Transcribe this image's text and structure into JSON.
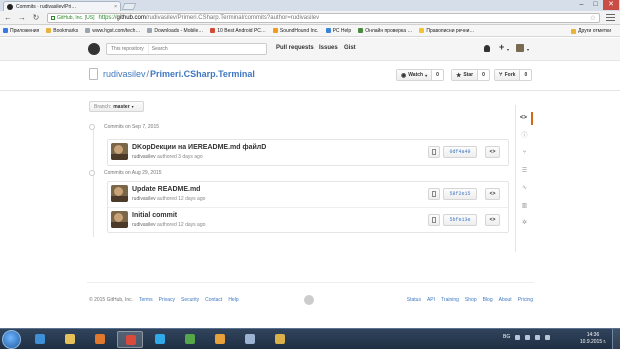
{
  "browser": {
    "tab_title": "Commits · rudivasilev/Pri…",
    "tab_close": "×",
    "win_min": "–",
    "win_max": "□",
    "win_close": "✕",
    "ev_cert": "GitHub, Inc. [US]",
    "url_https": "https://",
    "url_host": "github.com",
    "url_path": "/rudivasilev/Primeri.CSharp.Terminal/commits?author=rudivasilev",
    "back": "←",
    "forward": "→",
    "reload": "↻",
    "star": "☆",
    "bookmarks": [
      {
        "label": "Приложения",
        "color": "#3b78e7"
      },
      {
        "label": "Bookmarks",
        "color": "#e8b33b"
      },
      {
        "label": "www.hgst.com/tech…",
        "color": "#9aa5b1"
      },
      {
        "label": "Downloads - Mobile…",
        "color": "#9aa5b1"
      },
      {
        "label": "10 Best Android PC…",
        "color": "#d24b36"
      },
      {
        "label": "SoundHound Inc.",
        "color": "#f39b1d"
      },
      {
        "label": "PC Help",
        "color": "#3a84d6"
      },
      {
        "label": "Онлайн проверка …",
        "color": "#4a8a3c"
      },
      {
        "label": "Правописни речни…",
        "color": "#f0c234"
      }
    ],
    "other_bookmarks": "Други отметки"
  },
  "github": {
    "search_scope": "This repository",
    "search_placeholder": "Search",
    "nav": [
      "Pull requests",
      "Issues",
      "Gist"
    ],
    "plus": "+",
    "caret": "▾"
  },
  "repo": {
    "owner": "rudivasilev",
    "separator": "/",
    "name": "Primeri.CSharp.Terminal",
    "watch_label": "Watch",
    "watch_icon": "◉",
    "watch_caret": "▾",
    "watch_count": "0",
    "star_label": "Star",
    "star_icon": "★",
    "star_count": "0",
    "fork_label": "Fork",
    "fork_icon": "⑂",
    "fork_count": "0"
  },
  "branch": {
    "label": "Branch:",
    "value": "master",
    "caret": "▾"
  },
  "commit_groups": [
    {
      "date": "Commits on Sep 7, 2015",
      "commits": [
        {
          "title": "DKopDекции на ИEREADME.md файлD",
          "author": "rudivasilev",
          "meta": "authored 3 days ago",
          "sha": "0df4a49",
          "browse": "<>"
        }
      ]
    },
    {
      "date": "Commits on Aug 29, 2015",
      "commits": [
        {
          "title": "Update README.md",
          "author": "rudivasilev",
          "meta": "authored 12 days ago",
          "sha": "58f2e15",
          "browse": "<>"
        },
        {
          "title": "Initial commit",
          "author": "rudivasilev",
          "meta": "authored 12 days ago",
          "sha": "5bfe13e",
          "browse": "<>"
        }
      ]
    }
  ],
  "repo_nav": [
    {
      "name": "code",
      "glyph": "<>"
    },
    {
      "name": "issues",
      "glyph": "ⓘ"
    },
    {
      "name": "pull-requests",
      "glyph": "⑂"
    },
    {
      "name": "wiki",
      "glyph": "☰"
    },
    {
      "name": "pulse",
      "glyph": "∿"
    },
    {
      "name": "graphs",
      "glyph": "▥"
    },
    {
      "name": "settings",
      "glyph": "✲"
    }
  ],
  "footer": {
    "copyright": "© 2015 GitHub, Inc.",
    "left_links": [
      "Terms",
      "Privacy",
      "Security",
      "Contact",
      "Help"
    ],
    "right_links": [
      "Status",
      "API",
      "Training",
      "Shop",
      "Blog",
      "About",
      "Pricing"
    ]
  },
  "taskbar": {
    "lang": "BG",
    "time": "14:36",
    "date": "10.9.2015 г.",
    "apps": [
      {
        "name": "ie",
        "color": "#3d8fd8",
        "open": false
      },
      {
        "name": "explorer",
        "color": "#e6c15a",
        "open": false
      },
      {
        "name": "media-player",
        "color": "#e0782e",
        "open": false
      },
      {
        "name": "chrome",
        "color": "#d94a3d",
        "open": true
      },
      {
        "name": "skype",
        "color": "#2fa9e8",
        "open": false
      },
      {
        "name": "app-green",
        "color": "#55a84a",
        "open": false
      },
      {
        "name": "app-orange",
        "color": "#e8a23b",
        "open": false
      },
      {
        "name": "app-window",
        "color": "#9cb4d2",
        "open": false
      },
      {
        "name": "app-folder",
        "color": "#d9b04a",
        "open": false
      }
    ]
  }
}
